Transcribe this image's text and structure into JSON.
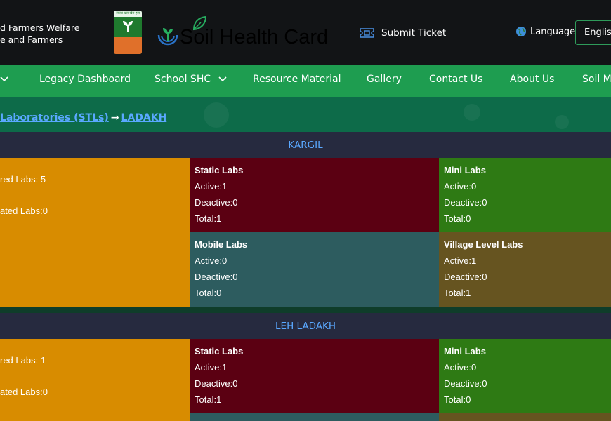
{
  "header": {
    "ministry_line1": "d Farmers Welfare",
    "ministry_line2": "e and Farmers",
    "emblem_text": "स्वस्थ धरा खेत हरा",
    "brand_title": "Soil Health Card",
    "submit_ticket": "Submit Ticket",
    "language_label": "Language",
    "language_value": "English"
  },
  "nav": {
    "items": [
      "",
      "Legacy Dashboard",
      "School SHC",
      "Resource Material",
      "Gallery",
      "Contact Us",
      "About Us",
      "Soil M"
    ]
  },
  "breadcrumb": {
    "parent": "Laboratories (STLs)",
    "arrow": "→",
    "current": "LADAKH"
  },
  "districts": [
    {
      "name": "KARGIL",
      "summary": {
        "registered": "red Labs: 5",
        "deactivated": "ated Labs:0"
      },
      "labs": {
        "static": {
          "title": "Static Labs",
          "active": "Active:1",
          "deactive": "Deactive:0",
          "total": "Total:1"
        },
        "mini": {
          "title": "Mini Labs",
          "active": "Active:0",
          "deactive": "Deactive:0",
          "total": "Total:0"
        },
        "mobile": {
          "title": "Mobile Labs",
          "active": "Active:0",
          "deactive": "Deactive:0",
          "total": "Total:0"
        },
        "village": {
          "title": "Village Level Labs",
          "active": "Active:1",
          "deactive": "Deactive:0",
          "total": "Total:1"
        }
      }
    },
    {
      "name": "LEH LADAKH",
      "summary": {
        "registered": "red Labs: 1",
        "deactivated": "ated Labs:0"
      },
      "labs": {
        "static": {
          "title": "Static Labs",
          "active": "Active:1",
          "deactive": "Deactive:0",
          "total": "Total:1"
        },
        "mini": {
          "title": "Mini Labs",
          "active": "Active:0",
          "deactive": "Deactive:0",
          "total": "Total:0"
        }
      }
    }
  ],
  "colors": {
    "header_bg": "#121416",
    "nav_bg": "#1e9d50",
    "breadcrumb_bg": "#0d6b49",
    "district_bar": "#262a3f",
    "link": "#5aa8ff",
    "summary_bg": "#d88c00",
    "static_bg": "#5b0012",
    "mini_bg": "#2e7a14",
    "mobile_bg": "#2d5c5f",
    "village_bg": "#665420"
  },
  "icons": [
    "chevron-down-icon",
    "ticket-icon",
    "globe-icon",
    "leaf-icon",
    "seedling-icon",
    "hands-plant-icon"
  ]
}
